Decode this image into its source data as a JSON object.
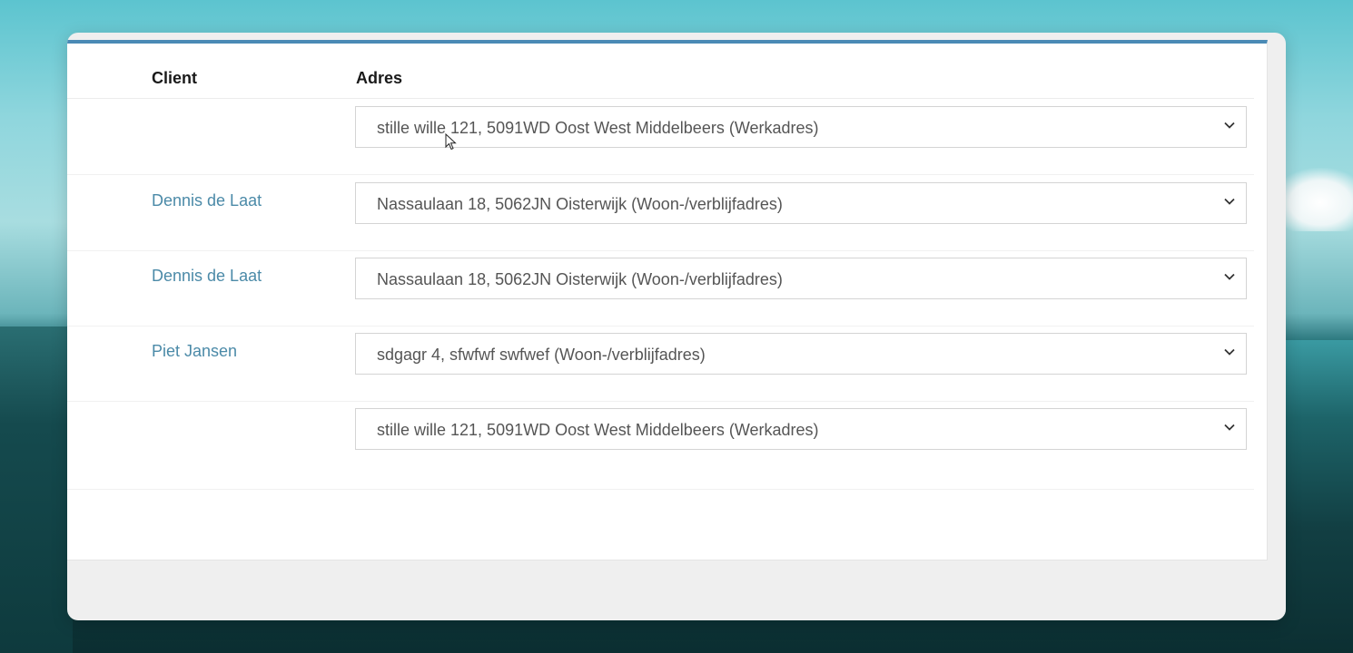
{
  "table": {
    "headers": {
      "client": "Client",
      "adres": "Adres"
    },
    "rows": [
      {
        "client": "",
        "address": "stille wille 121, 5091WD Oost West Middelbeers (Werkadres)"
      },
      {
        "client": "Dennis de Laat",
        "address": "Nassaulaan 18, 5062JN Oisterwijk (Woon-/verblijfadres)"
      },
      {
        "client": "Dennis de Laat",
        "address": "Nassaulaan 18, 5062JN Oisterwijk (Woon-/verblijfadres)"
      },
      {
        "client": "Piet Jansen",
        "address": "sdgagr 4, sfwfwf swfwef (Woon-/verblijfadres)"
      },
      {
        "client": "",
        "address": "stille wille 121, 5091WD Oost West Middelbeers (Werkadres)"
      }
    ]
  },
  "icons": {
    "dropdown": "chevron-down-icon",
    "pointer": "mouse-cursor-icon"
  },
  "colors": {
    "accent": "#4a8ab5",
    "link": "#4b8aa8"
  }
}
